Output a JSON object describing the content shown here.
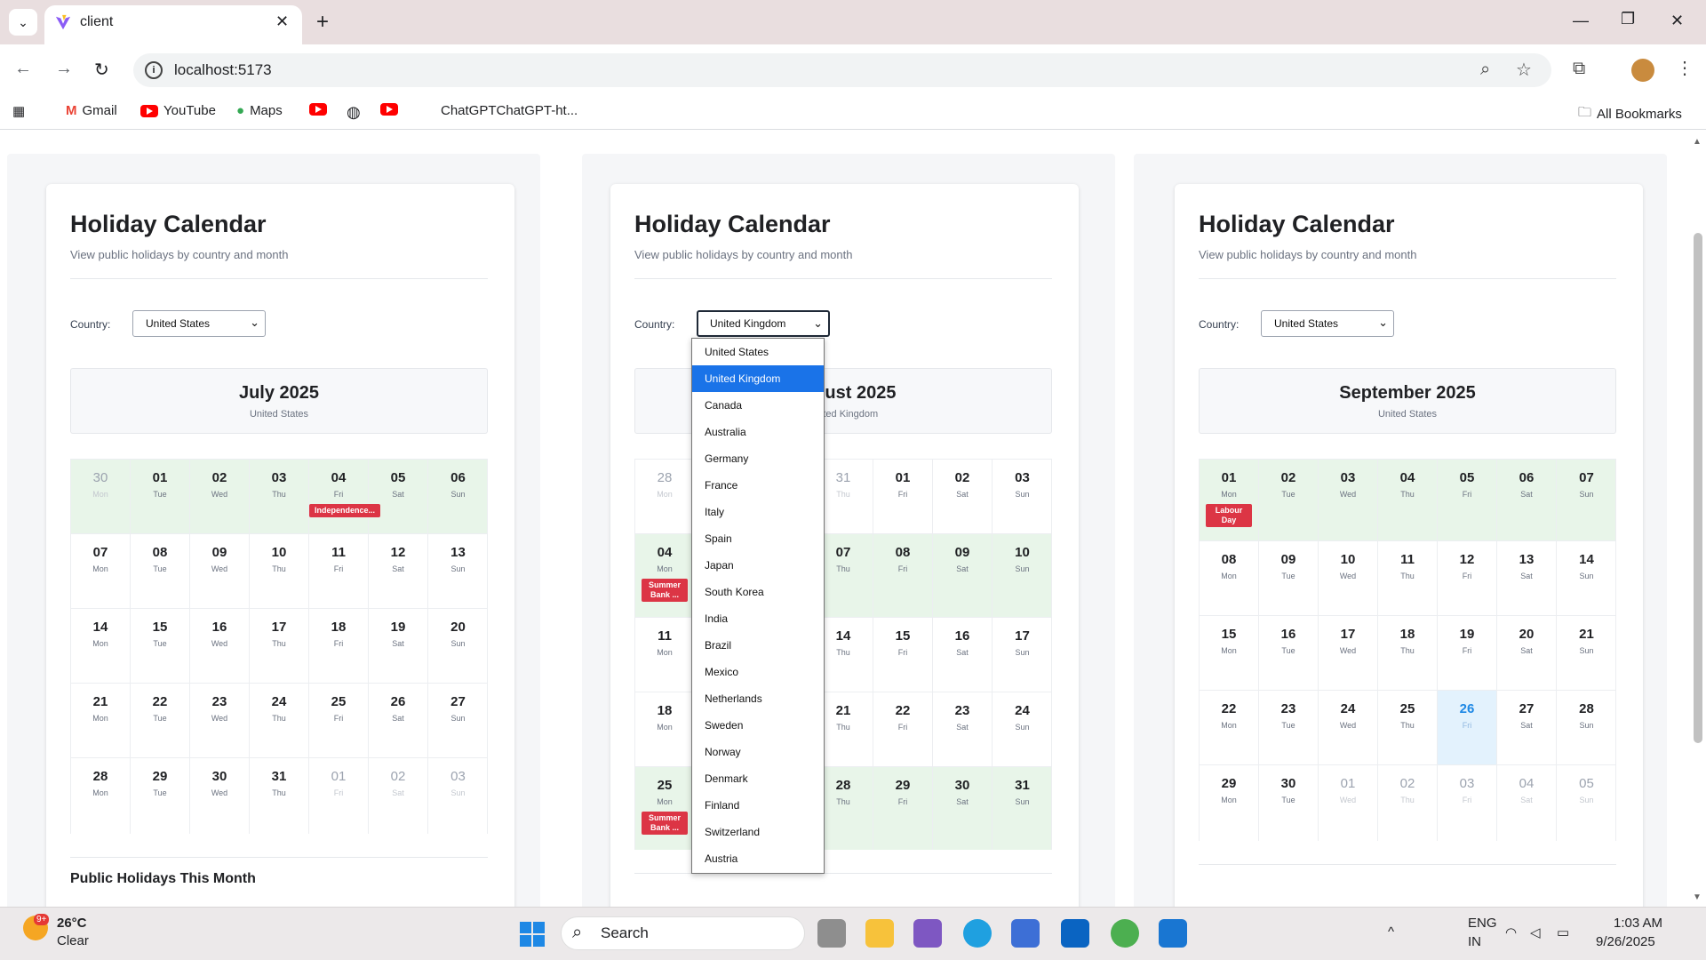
{
  "browser": {
    "tab_title": "client",
    "url": "localhost:5173",
    "bookmarks": [
      "Gmail",
      "YouTube",
      "Maps",
      "ChatGPTChatGPT-ht...",
      "All Bookmarks"
    ]
  },
  "calendars": [
    {
      "title": "Holiday Calendar",
      "subtitle": "View public holidays by country and month",
      "country_label": "Country:",
      "selected_country": "United States",
      "month": "July 2025",
      "month_country": "United States",
      "section_hint": "Public Holidays This Month",
      "weeks": [
        [
          {
            "d": "30",
            "w": "Mon",
            "out": true
          },
          {
            "d": "01",
            "w": "Tue"
          },
          {
            "d": "02",
            "w": "Wed"
          },
          {
            "d": "03",
            "w": "Thu"
          },
          {
            "d": "04",
            "w": "Fri",
            "badge": "Independence..."
          },
          {
            "d": "05",
            "w": "Sat"
          },
          {
            "d": "06",
            "w": "Sun"
          }
        ],
        [
          {
            "d": "07",
            "w": "Mon"
          },
          {
            "d": "08",
            "w": "Tue"
          },
          {
            "d": "09",
            "w": "Wed"
          },
          {
            "d": "10",
            "w": "Thu"
          },
          {
            "d": "11",
            "w": "Fri"
          },
          {
            "d": "12",
            "w": "Sat"
          },
          {
            "d": "13",
            "w": "Sun"
          }
        ],
        [
          {
            "d": "14",
            "w": "Mon"
          },
          {
            "d": "15",
            "w": "Tue"
          },
          {
            "d": "16",
            "w": "Wed"
          },
          {
            "d": "17",
            "w": "Thu"
          },
          {
            "d": "18",
            "w": "Fri"
          },
          {
            "d": "19",
            "w": "Sat"
          },
          {
            "d": "20",
            "w": "Sun"
          }
        ],
        [
          {
            "d": "21",
            "w": "Mon"
          },
          {
            "d": "22",
            "w": "Tue"
          },
          {
            "d": "23",
            "w": "Wed"
          },
          {
            "d": "24",
            "w": "Thu"
          },
          {
            "d": "25",
            "w": "Fri"
          },
          {
            "d": "26",
            "w": "Sat"
          },
          {
            "d": "27",
            "w": "Sun"
          }
        ],
        [
          {
            "d": "28",
            "w": "Mon"
          },
          {
            "d": "29",
            "w": "Tue"
          },
          {
            "d": "30",
            "w": "Wed"
          },
          {
            "d": "31",
            "w": "Thu"
          },
          {
            "d": "01",
            "w": "Fri",
            "out": true
          },
          {
            "d": "02",
            "w": "Sat",
            "out": true
          },
          {
            "d": "03",
            "w": "Sun",
            "out": true
          }
        ]
      ],
      "holiday_weeks": [
        0
      ]
    },
    {
      "title": "Holiday Calendar",
      "subtitle": "View public holidays by country and month",
      "country_label": "Country:",
      "selected_country": "United Kingdom",
      "month": "August 2025",
      "month_country": "United Kingdom",
      "section_hint": "",
      "weeks": [
        [
          {
            "d": "28",
            "w": "Mon",
            "out": true
          },
          {
            "d": "29",
            "w": "Tue",
            "out": true
          },
          {
            "d": "30",
            "w": "Wed",
            "out": true
          },
          {
            "d": "31",
            "w": "Thu",
            "out": true
          },
          {
            "d": "01",
            "w": "Fri"
          },
          {
            "d": "02",
            "w": "Sat"
          },
          {
            "d": "03",
            "w": "Sun"
          }
        ],
        [
          {
            "d": "04",
            "w": "Mon",
            "badge": "Summer Bank ..."
          },
          {
            "d": "05",
            "w": "Tue"
          },
          {
            "d": "06",
            "w": "Wed"
          },
          {
            "d": "07",
            "w": "Thu"
          },
          {
            "d": "08",
            "w": "Fri"
          },
          {
            "d": "09",
            "w": "Sat"
          },
          {
            "d": "10",
            "w": "Sun"
          }
        ],
        [
          {
            "d": "11",
            "w": "Mon"
          },
          {
            "d": "12",
            "w": "Tue"
          },
          {
            "d": "13",
            "w": "Wed"
          },
          {
            "d": "14",
            "w": "Thu"
          },
          {
            "d": "15",
            "w": "Fri"
          },
          {
            "d": "16",
            "w": "Sat"
          },
          {
            "d": "17",
            "w": "Sun"
          }
        ],
        [
          {
            "d": "18",
            "w": "Mon"
          },
          {
            "d": "19",
            "w": "Tue"
          },
          {
            "d": "20",
            "w": "Wed"
          },
          {
            "d": "21",
            "w": "Thu"
          },
          {
            "d": "22",
            "w": "Fri"
          },
          {
            "d": "23",
            "w": "Sat"
          },
          {
            "d": "24",
            "w": "Sun"
          }
        ],
        [
          {
            "d": "25",
            "w": "Mon",
            "badge": "Summer Bank ..."
          },
          {
            "d": "26",
            "w": "Tue"
          },
          {
            "d": "27",
            "w": "Wed"
          },
          {
            "d": "28",
            "w": "Thu"
          },
          {
            "d": "29",
            "w": "Fri"
          },
          {
            "d": "30",
            "w": "Sat"
          },
          {
            "d": "31",
            "w": "Sun"
          }
        ]
      ],
      "holiday_weeks": [
        1,
        4
      ]
    },
    {
      "title": "Holiday Calendar",
      "subtitle": "View public holidays by country and month",
      "country_label": "Country:",
      "selected_country": "United States",
      "month": "September 2025",
      "month_country": "United States",
      "section_hint": "",
      "weeks": [
        [
          {
            "d": "01",
            "w": "Mon",
            "badge": "Labour Day"
          },
          {
            "d": "02",
            "w": "Tue"
          },
          {
            "d": "03",
            "w": "Wed"
          },
          {
            "d": "04",
            "w": "Thu"
          },
          {
            "d": "05",
            "w": "Fri"
          },
          {
            "d": "06",
            "w": "Sat"
          },
          {
            "d": "07",
            "w": "Sun"
          }
        ],
        [
          {
            "d": "08",
            "w": "Mon"
          },
          {
            "d": "09",
            "w": "Tue"
          },
          {
            "d": "10",
            "w": "Wed"
          },
          {
            "d": "11",
            "w": "Thu"
          },
          {
            "d": "12",
            "w": "Fri"
          },
          {
            "d": "13",
            "w": "Sat"
          },
          {
            "d": "14",
            "w": "Sun"
          }
        ],
        [
          {
            "d": "15",
            "w": "Mon"
          },
          {
            "d": "16",
            "w": "Tue"
          },
          {
            "d": "17",
            "w": "Wed"
          },
          {
            "d": "18",
            "w": "Thu"
          },
          {
            "d": "19",
            "w": "Fri"
          },
          {
            "d": "20",
            "w": "Sat"
          },
          {
            "d": "21",
            "w": "Sun"
          }
        ],
        [
          {
            "d": "22",
            "w": "Mon"
          },
          {
            "d": "23",
            "w": "Tue"
          },
          {
            "d": "24",
            "w": "Wed"
          },
          {
            "d": "25",
            "w": "Thu"
          },
          {
            "d": "26",
            "w": "Fri",
            "today": true
          },
          {
            "d": "27",
            "w": "Sat"
          },
          {
            "d": "28",
            "w": "Sun"
          }
        ],
        [
          {
            "d": "29",
            "w": "Mon"
          },
          {
            "d": "30",
            "w": "Tue"
          },
          {
            "d": "01",
            "w": "Wed",
            "out": true
          },
          {
            "d": "02",
            "w": "Thu",
            "out": true
          },
          {
            "d": "03",
            "w": "Fri",
            "out": true
          },
          {
            "d": "04",
            "w": "Sat",
            "out": true
          },
          {
            "d": "05",
            "w": "Sun",
            "out": true
          }
        ]
      ],
      "holiday_weeks": [
        0
      ]
    }
  ],
  "country_options": [
    "United States",
    "United Kingdom",
    "Canada",
    "Australia",
    "Germany",
    "France",
    "Italy",
    "Spain",
    "Japan",
    "South Korea",
    "India",
    "Brazil",
    "Mexico",
    "Netherlands",
    "Sweden",
    "Norway",
    "Denmark",
    "Finland",
    "Switzerland",
    "Austria"
  ],
  "dropdown_selected": "United Kingdom",
  "taskbar": {
    "weather_temp": "26°C",
    "weather_desc": "Clear",
    "weather_badge": "9+",
    "search_label": "Search",
    "lang": "ENG",
    "region": "IN",
    "time": "1:03 AM",
    "date": "9/26/2025"
  },
  "colors": {
    "holiday_row": "#e8f5e9",
    "badge": "#dc3545",
    "today": "#e3f2fd",
    "selected_option": "#1a73e8"
  }
}
